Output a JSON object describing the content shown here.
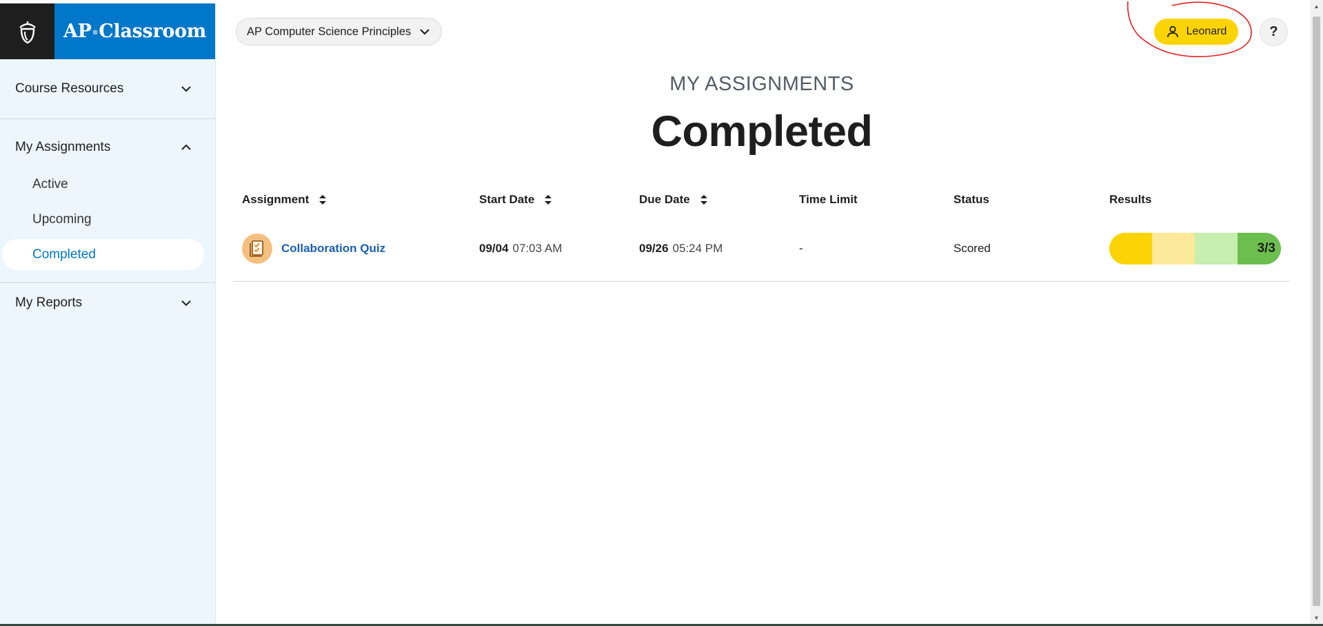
{
  "brand": {
    "prefix": "AP",
    "trademark": "®",
    "suffix": "Classroom"
  },
  "course_selector": {
    "label": "AP Computer Science Principles"
  },
  "user": {
    "name": "Leonard"
  },
  "help": {
    "label": "?"
  },
  "sidebar": {
    "sections": [
      {
        "label": "Course Resources"
      },
      {
        "label": "My Assignments",
        "items": [
          {
            "label": "Active"
          },
          {
            "label": "Upcoming"
          },
          {
            "label": "Completed"
          }
        ]
      },
      {
        "label": "My Reports"
      }
    ]
  },
  "page": {
    "eyebrow": "MY ASSIGNMENTS",
    "title": "Completed"
  },
  "table": {
    "columns": [
      "Assignment",
      "Start Date",
      "Due Date",
      "Time Limit",
      "Status",
      "Results"
    ],
    "rows": [
      {
        "assignment": "Collaboration Quiz",
        "start_date": "09/04",
        "start_time": "07:03 AM",
        "due_date": "09/26",
        "due_time": "05:24 PM",
        "time_limit": "-",
        "status": "Scored",
        "result": "3/3"
      }
    ]
  },
  "colors": {
    "brand_blue": "#0077c8",
    "user_yellow": "#fcd405",
    "link_blue": "#1a5fb4",
    "sidebar_bg": "#eef6fd",
    "annotation_red": "#e02020"
  }
}
